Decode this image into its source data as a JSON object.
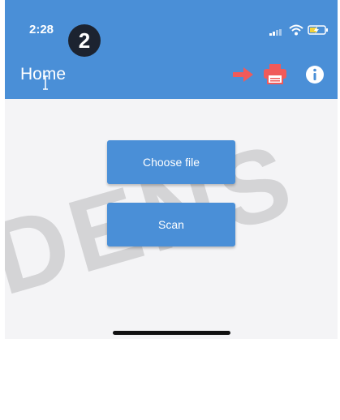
{
  "status_bar": {
    "time": "2:28",
    "signal_icon": "cellular-signal-icon",
    "wifi_icon": "wifi-icon",
    "battery_icon": "battery-charging-icon"
  },
  "step_badge": "2",
  "app_bar": {
    "title": "Home",
    "actions": [
      "arrow-right-icon",
      "printer-icon",
      "info-icon"
    ],
    "accent_color": "#4a8fd7",
    "action_color": "#f05a5a"
  },
  "main": {
    "choose_file_label": "Choose file",
    "scan_label": "Scan"
  },
  "watermark": "DENS"
}
